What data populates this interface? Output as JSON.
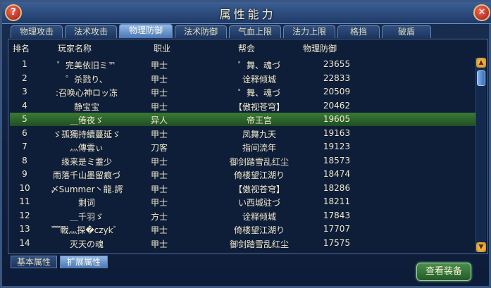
{
  "window": {
    "title": "属性能力",
    "help_label": "?",
    "close_label": "✕"
  },
  "tabs": [
    {
      "label": "物理攻击"
    },
    {
      "label": "法术攻击"
    },
    {
      "label": "物理防御"
    },
    {
      "label": "法术防御"
    },
    {
      "label": "气血上限"
    },
    {
      "label": "法力上限"
    },
    {
      "label": "格挡"
    },
    {
      "label": "破盾"
    }
  ],
  "table": {
    "headers": {
      "rank": "排名",
      "name": "玩家名称",
      "job": "职业",
      "guild": "帮会",
      "defense": "物理防御"
    },
    "rows": [
      {
        "rank": "1",
        "name": "゜完美依旧ミ™",
        "job": "甲士",
        "guild": "゜舞、魂づ",
        "defense": "23655"
      },
      {
        "rank": "2",
        "name": "゜杀戮り、",
        "job": "甲士",
        "guild": "诠释倾城",
        "defense": "22833"
      },
      {
        "rank": "3",
        "name": ":召唤心神ロッ冻",
        "job": "甲士",
        "guild": "゜舞、魂づ",
        "defense": "20509"
      },
      {
        "rank": "4",
        "name": "静宝宝",
        "job": "甲士",
        "guild": "【傲视苍穹】",
        "defense": "20462"
      },
      {
        "rank": "5",
        "name": "＿倦夜ゞ",
        "job": "异人",
        "guild": "帝王宫",
        "defense": "19605"
      },
      {
        "rank": "6",
        "name": "ゞ孤獨持續蔓延ゞ",
        "job": "甲士",
        "guild": "凤舞九天",
        "defense": "19163"
      },
      {
        "rank": "7",
        "name": "灬傳雲ぃ",
        "job": "刀客",
        "guild": "指间流年",
        "defense": "19123"
      },
      {
        "rank": "8",
        "name": "缘来是ミ耋少",
        "job": "甲士",
        "guild": "御剑踏雪乱红尘",
        "defense": "18573"
      },
      {
        "rank": "9",
        "name": "雨落千山墨留痕づ",
        "job": "甲士",
        "guild": "倚楼望江湖り",
        "defense": "18474"
      },
      {
        "rank": "10",
        "name": "〆Summer丶龍.諤",
        "job": "甲士",
        "guild": "【傲视苍穹】",
        "defense": "18286"
      },
      {
        "rank": "11",
        "name": "剩词",
        "job": "甲士",
        "guild": "い西城驻づ",
        "defense": "18211"
      },
      {
        "rank": "12",
        "name": "＿千羽ゞ",
        "job": "方士",
        "guild": "诠释倾城",
        "defense": "17843"
      },
      {
        "rank": "13",
        "name": "﹌戰灬探�czyk゛",
        "job": "甲士",
        "guild": "倚楼望江湖り",
        "defense": "17707"
      },
      {
        "rank": "14",
        "name": "灭天の魂",
        "job": "甲士",
        "guild": "御剑踏雪乱红尘",
        "defense": "17575"
      }
    ],
    "selected_index": 4
  },
  "scrollbar": {
    "up_icon": "▲",
    "down_icon": "▼"
  },
  "bottom_tabs": [
    {
      "label": "基本属性"
    },
    {
      "label": "扩展属性"
    }
  ],
  "equip_button": {
    "label": "查看装备"
  }
}
